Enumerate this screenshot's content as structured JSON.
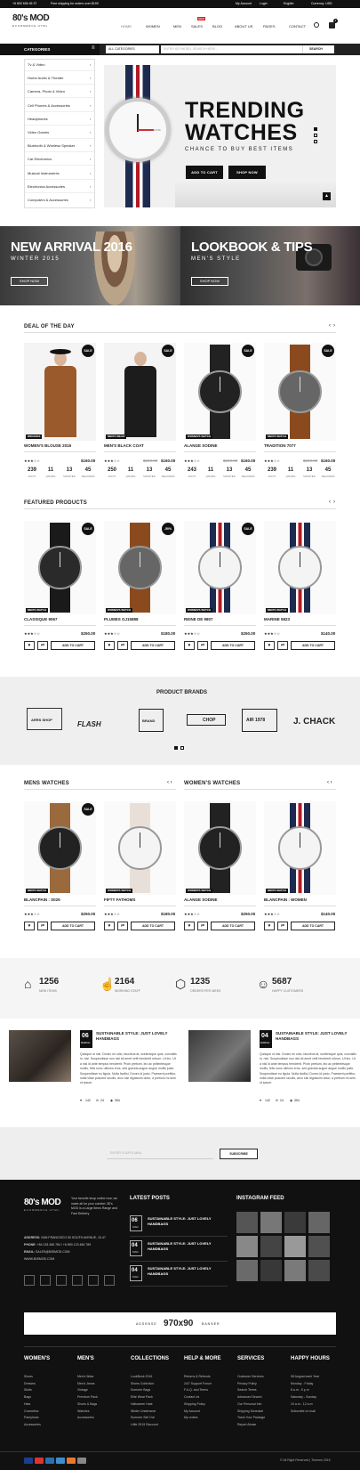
{
  "topbar": {
    "phone": "+6 800 606 45 37",
    "shipping": "Free shipping for orders over $199",
    "account": "My Account",
    "login": "Login",
    "language": "English",
    "currency": "Currency: USD"
  },
  "logo": {
    "main": "80's MOD",
    "tagline": "ECOMMERCE HTML"
  },
  "nav": {
    "home": "HOME",
    "women": "WOMEN",
    "men": "MEN",
    "sales": "SALES",
    "sales_badge": "NEW",
    "blog": "BLOG",
    "about": "ABOUT US",
    "pages": "PAGES",
    "contact": "CONTACT",
    "cart_count": "2"
  },
  "catbar": {
    "title": "CATEGORIES",
    "select": "ALL CATEGORIES",
    "search_placeholder": "ENTER KEYWORD, SEARCH HERE...",
    "search_button": "SEARCH"
  },
  "categories": [
    "Tv & Video",
    "Home Audio & Theater",
    "Camera, Photo & Video",
    "Cell Phones & Accessories",
    "Headphones",
    "Video Games",
    "Bluetooth & Wireless Speaker",
    "Car Electronics",
    "Musical Instruments",
    "Electronics Accessories",
    "Computers & Accessories"
  ],
  "hero": {
    "title1": "TRENDING",
    "title2": "WATCHES",
    "subtitle": "CHANCE TO BUY BEST ITEMS",
    "btn_cart": "ADD TO CART",
    "btn_shop": "SHOP NOW",
    "watch_brand": "SOME"
  },
  "banners": [
    {
      "title": "NEW ARRIVAL 2016",
      "subtitle": "WINTER 2015",
      "button": "SHOP NOW"
    },
    {
      "title": "LOOKBOOK & TIPS",
      "subtitle": "MEN'S STYLE",
      "button": "SHOP NOW"
    }
  ],
  "deal": {
    "title": "DEAL OF THE DAY",
    "count_labels": [
      "DAYS",
      "HOURS",
      "MINUTES",
      "SECONDS"
    ],
    "items": [
      {
        "tag": "DRESSES",
        "name": "WOMEN'S BLOUSE 2016",
        "price": "$160.00",
        "old": "",
        "badge": "SALE",
        "rating": 3,
        "count": [
          "239",
          "11",
          "13",
          "45"
        ]
      },
      {
        "tag": "MEN'S WEAR",
        "name": "MEN'S BLACK COAT",
        "price": "$160.00",
        "old": "$250.00",
        "badge": "SALE",
        "rating": 3,
        "count": [
          "250",
          "11",
          "13",
          "45"
        ]
      },
      {
        "tag": "WOMEN'S WATCH",
        "name": "ALANGE SODINE",
        "price": "$160.00",
        "old": "$250.00",
        "badge": "SALE",
        "rating": 3,
        "count": [
          "243",
          "11",
          "13",
          "45"
        ]
      },
      {
        "tag": "MEN'S WATCH",
        "name": "TRADITION 7077",
        "price": "$160.00",
        "old": "$250.00",
        "badge": "SALE",
        "rating": 3,
        "count": [
          "239",
          "11",
          "13",
          "45"
        ]
      }
    ]
  },
  "featured": {
    "title": "FEATURED PRODUCTS",
    "add_to_cart": "ADD TO CART",
    "items": [
      {
        "tag": "MEN'S WATCH",
        "name": "CLASSIQUE 9067",
        "price": "$250.00",
        "old": "",
        "badge": "SALE",
        "rating": 3
      },
      {
        "tag": "WOMEN'S WATCH",
        "name": "PLUMES GJ15888",
        "price": "$180.00",
        "old": "",
        "badge": "-50%",
        "rating": 3
      },
      {
        "tag": "WOMEN'S WATCH",
        "name": "REINE DE 9807",
        "price": "$250.00",
        "old": "",
        "badge": "SALE",
        "rating": 3
      },
      {
        "tag": "MEN'S WATCH",
        "name": "MARINE 5823",
        "price": "$140.00",
        "old": "",
        "badge": "",
        "rating": 3
      }
    ]
  },
  "brands": {
    "title": "PRODUCT BRANDS",
    "items": [
      "ARRS SHOP",
      "FLASH",
      "BRAND",
      "CHOP",
      "AIR 1978",
      "J. CHACK"
    ]
  },
  "mens": {
    "title": "MENS WATCHES",
    "items": [
      {
        "tag": "MEN'S WATCH",
        "name": "BLANCPAIN : S025",
        "price": "$250.00",
        "badge": "SALE",
        "rating": 3
      },
      {
        "tag": "WOMEN'S WATCH",
        "name": "FIFTY FATHOMS",
        "price": "$180.00",
        "badge": "",
        "rating": 3
      }
    ]
  },
  "womens": {
    "title": "WOMEN'S WATCHES",
    "items": [
      {
        "tag": "WOMEN'S WATCH",
        "name": "ALANGE SODINE",
        "price": "$250.00",
        "badge": "",
        "rating": 3
      },
      {
        "tag": "MEN'S WATCH",
        "name": "BLANCPAIN : WOMEN",
        "price": "$140.00",
        "badge": "",
        "rating": 3
      }
    ]
  },
  "stats": [
    {
      "num": "1256",
      "label": "NEW ITEMS",
      "icon": "bag-icon"
    },
    {
      "num": "2164",
      "label": "WORKING STAFF",
      "icon": "hand-icon"
    },
    {
      "num": "1235",
      "label": "ORDERS PER WEEK",
      "icon": "hexagon-icon"
    },
    {
      "num": "5687",
      "label": "HAPPY CUSTOMERS",
      "icon": "smile-icon"
    }
  ],
  "posts": [
    {
      "day": "06",
      "month": "MARCH",
      "title": "SUSTAINABLE STYLE: JUST LOVELY HANDBAGS",
      "excerpt": "Quisque ut nisi. Donec mi odio, faucibus at, scelerisque quis, convallis in, nisi. Suspendisse non nisl sit amet velit hendrerit rutrum. Ut leo. Ut a nisl id ante tempus hendrerit. Proin pretium, leo ac pellentesque mollis, felis nunc ultrices eros, sed gravida augue augue mollis justo. Suspendisse eu ligula. Nulla facilisi. Donec id justo. Praesent porttitor, nulla vitae posuere iaculis, arcu nisl dignissim dolor, a pretium mi sem ut ipsum.",
      "likes": "142",
      "comments": "24",
      "views": "354"
    },
    {
      "day": "04",
      "month": "MARCH",
      "title": "SUSTAINABLE STYLE: JUST LOVELY HANDBAGS",
      "excerpt": "Quisque ut nisi. Donec mi odio, faucibus at, scelerisque quis, convallis in, nisi. Suspendisse non nisl sit amet velit hendrerit rutrum. Ut leo. Ut a nisl id ante tempus hendrerit. Proin pretium, leo ac pellentesque mollis, felis nunc ultrices eros, sed gravida augue augue mollis justo. Suspendisse eu ligula. Nulla facilisi. Donec id justo. Praesent porttitor, nulla vitae posuere iaculis, arcu nisl dignissim dolor, a pretium mi sem ut ipsum.",
      "likes": "142",
      "comments": "24",
      "views": "354"
    }
  ],
  "newsletter": {
    "placeholder": "ENTER YOUR E-MAIL",
    "button": "SUBSCRIBE"
  },
  "footer": {
    "about": "Your favorite shop online now, we make all for your comfort. 80's MOD is a Large items Range and Fast Delivery",
    "address_label": "ADDRESS:",
    "address": "SAN FRANCISCO 50 SOUTH AVENUE, 10-47",
    "phone_label": "PHONE:",
    "phone": "+84 133 456 784 / +6 890 123 456 789",
    "email_label": "EMAIL:",
    "email": "SALES@80SMOD.COM",
    "web": "WWW.80SMOD.COM",
    "latest_title": "LATEST POSTS",
    "latest": [
      {
        "day": "06",
        "month": "MAR",
        "title": "SUSTAINABLE STYLE: JUST LOVELY HANDBAGS"
      },
      {
        "day": "04",
        "month": "MAR",
        "title": "SUSTAINABLE STYLE: JUST LOVELY HANDBAGS"
      },
      {
        "day": "04",
        "month": "MAR",
        "title": "SUSTAINABLE STYLE: JUST LOVELY HANDBAGS"
      }
    ],
    "insta_title": "INSTAGRAM FEED",
    "ad": {
      "prefix": "ADSENSE",
      "size": "970x90",
      "suffix": "BANNER"
    },
    "columns": [
      {
        "title": "WOMEN'S",
        "links": [
          "Shoes",
          "Dresses",
          "Skirts",
          "Bags",
          "Hats",
          "Cosmetics",
          "Pantyhose",
          "Accessories"
        ]
      },
      {
        "title": "MEN'S",
        "links": [
          "Men's Wear",
          "Men's Jeans",
          "Vintage",
          "Premium Pack",
          "Shoes & Bags",
          "Watches",
          "Accessories"
        ]
      },
      {
        "title": "COLLECTIONS",
        "links": [
          "LookBook 2016",
          "Shoes Collection",
          "Summer Bags",
          "Elite Wear Pack",
          "Halloween Hats",
          "Winter Underwear",
          "Summer Sell Out",
          "Little 2015 Discount"
        ]
      },
      {
        "title": "HELP & MORE",
        "links": [
          "Returns & Refunds",
          "24/7 Support Forum",
          "F.A.Q. and Terms",
          "Contact Us",
          "Shipping Policy",
          "My Account",
          "My orders"
        ]
      },
      {
        "title": "SERVICES",
        "links": [
          "Customer Services",
          "Privacy Policy",
          "Search Terms",
          "Advanced Search",
          "Our Personal Info",
          "Shipping Schedule",
          "Track Your Package",
          "Report Abuse"
        ]
      },
      {
        "title": "HAPPY HOURS",
        "links": [
          "08 August each Year",
          "Monday - Friday",
          "8 a.m - 5 p.m",
          "Saturday - Sunday",
          "10 a.m - 12 a.m",
          "Subscribe on mail"
        ]
      }
    ],
    "copyright": "© All Right Reserved | Themes 2016"
  }
}
